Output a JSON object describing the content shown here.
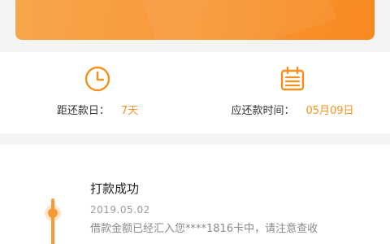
{
  "repayment": {
    "days_label": "距还款日：",
    "days_value": "7天",
    "due_label": "应还款时间：",
    "due_value": "05月09日",
    "clock_icon": "clock-icon",
    "calendar_icon": "calendar-icon"
  },
  "timeline": {
    "title": "打款成功",
    "date": "2019.05.02",
    "description": "借款金额已经汇入您****1816卡中，请注意查收"
  },
  "colors": {
    "accent": "#f5921e",
    "banner_start": "#f7a64c",
    "banner_end": "#f7891f"
  }
}
